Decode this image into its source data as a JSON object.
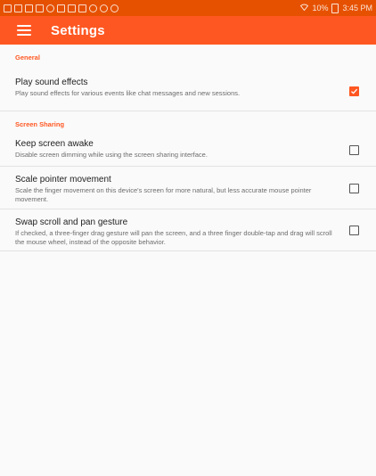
{
  "status_bar": {
    "battery_text": "10%",
    "time": "3:45 PM"
  },
  "app_bar": {
    "title": "Settings"
  },
  "sections": {
    "general": {
      "header": "General",
      "items": [
        {
          "title": "Play sound effects",
          "summary": "Play sound effects for various events like chat messages and new sessions.",
          "checked": true
        }
      ]
    },
    "screen_sharing": {
      "header": "Screen Sharing",
      "items": [
        {
          "title": "Keep screen awake",
          "summary": "Disable screen dimming while using the screen sharing interface.",
          "checked": false
        },
        {
          "title": "Scale pointer movement",
          "summary": "Scale the finger movement on this device's screen for more natural, but less accurate mouse pointer movement.",
          "checked": false
        },
        {
          "title": "Swap scroll and pan gesture",
          "summary": "If checked, a three-finger drag gesture will pan the screen, and a three finger double-tap and drag will scroll the mouse wheel, instead of the opposite behavior.",
          "checked": false
        }
      ]
    }
  },
  "colors": {
    "accent": "#ff5722",
    "status_bar": "#e65100",
    "background": "#fafafa"
  }
}
